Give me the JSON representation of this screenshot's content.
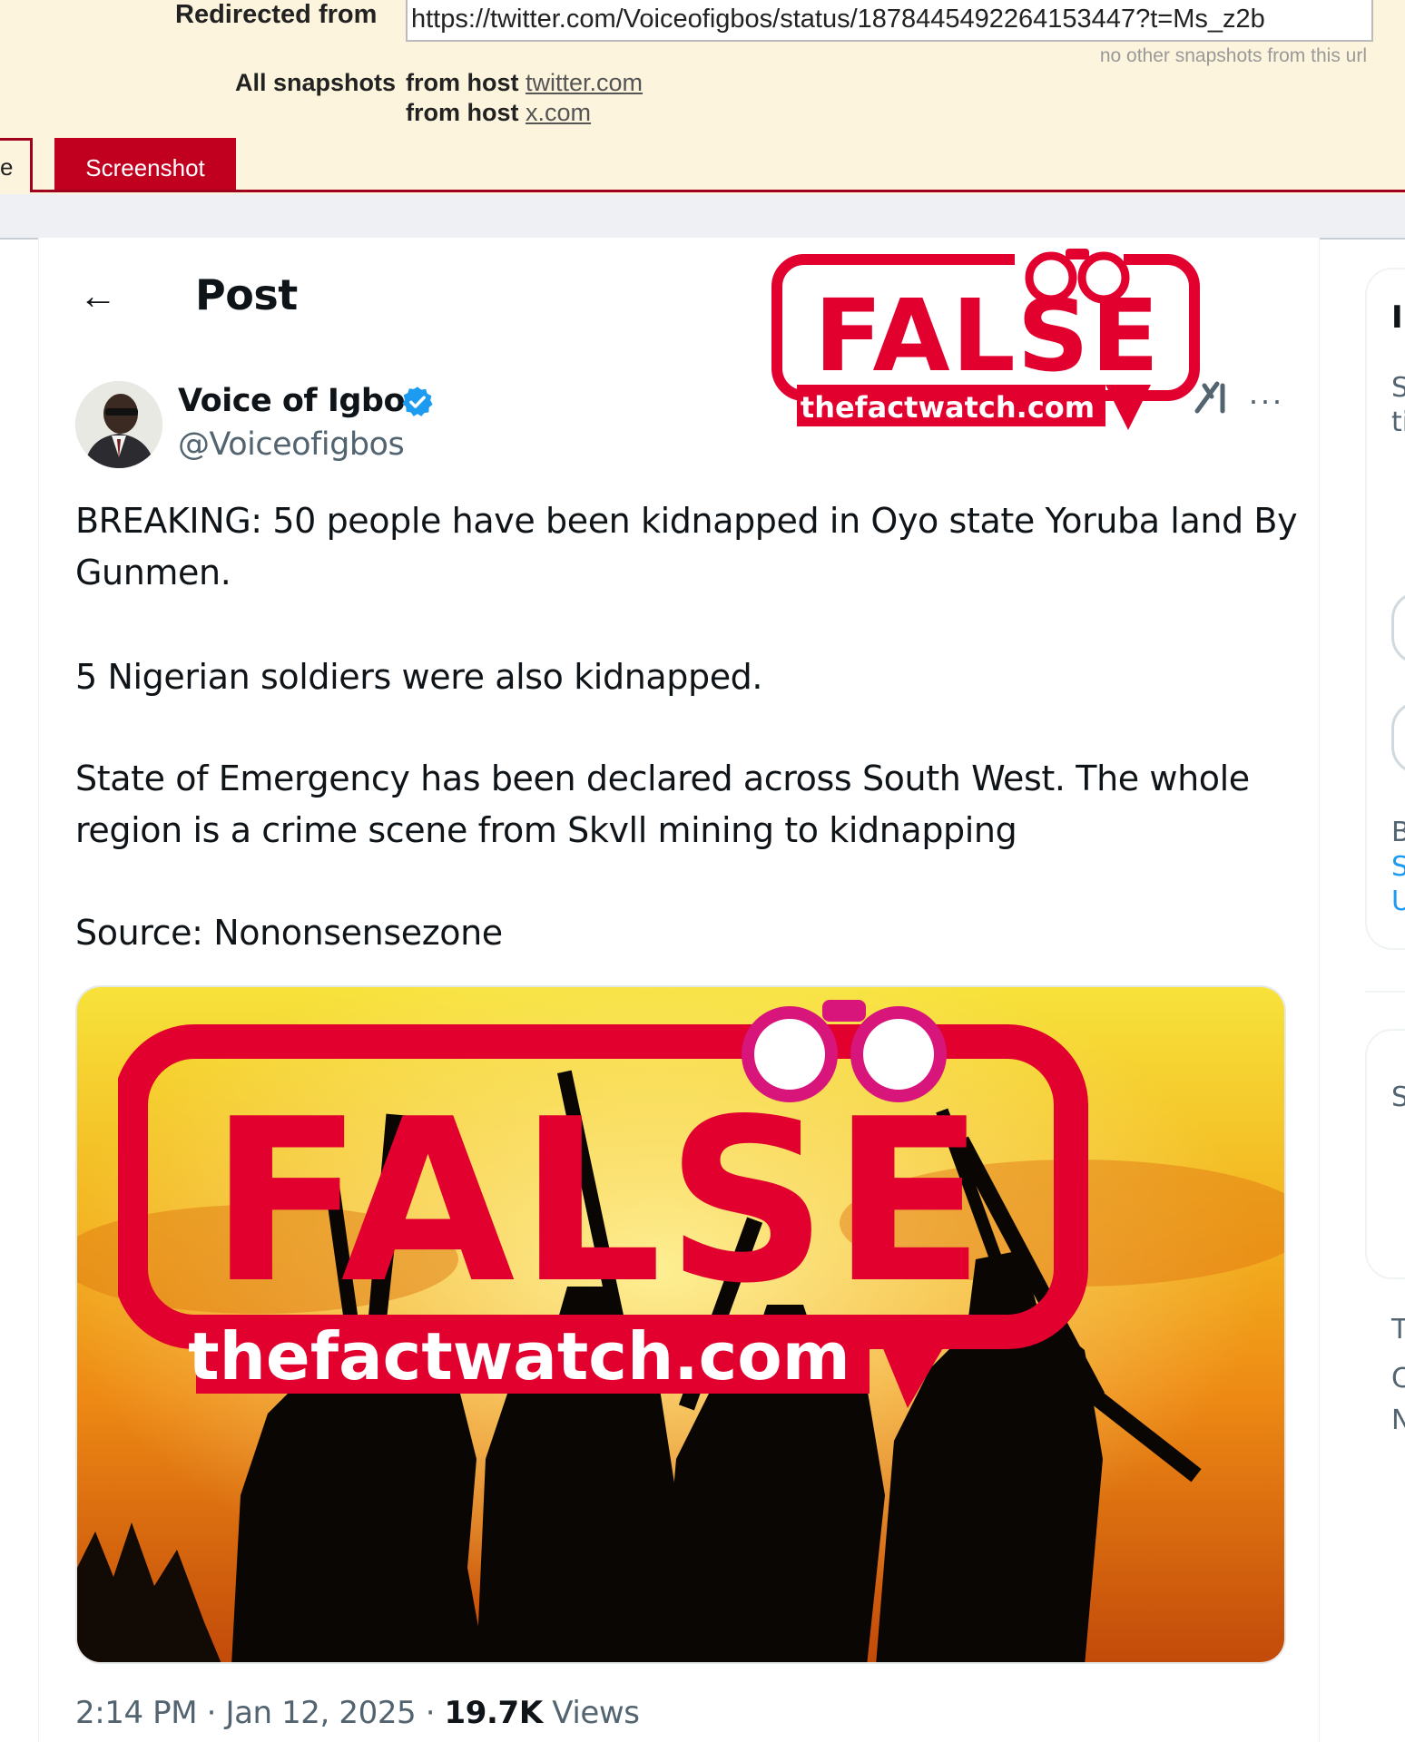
{
  "archive": {
    "redirected_label": "Redirected from",
    "redirected_url": "https://twitter.com/Voiceofigbos/status/1878445492264153447?t=Ms_z2b",
    "no_other_snapshots": "no other snapshots from this url",
    "all_snapshots_label": "All snapshots",
    "from_host_label": "from host",
    "hosts": [
      "twitter.com",
      "x.com"
    ],
    "tab_cut_label": "e",
    "active_tab": "Screenshot"
  },
  "post": {
    "header_title": "Post",
    "author_name": "Voice of Igbos",
    "author_handle": "@Voiceofigbos",
    "paragraphs": [
      "BREAKING: 50 people have been kidnapped in Oyo state Yoruba land By Gunmen.",
      "5 Nigerian soldiers were also kidnapped.",
      "State of Emergency has been declared  across South West. The whole region is a crime scene from Skvll mining to kidnapping",
      "Source: Nononsensezone"
    ],
    "time": "2:14 PM",
    "date": "Jan 12, 2025",
    "views_count": "19.7K",
    "views_label": "Views",
    "more_glyph": "···",
    "back_icon": "←"
  },
  "stamp": {
    "verdict": "FALSE",
    "site": "thefactwatch.com",
    "color": "#e2002f"
  },
  "sidebar_fragments": {
    "a": "S",
    "b": "ti",
    "c": "B",
    "d": "S",
    "e": "U",
    "f": "S",
    "g": "T",
    "h": "C",
    "i": "N"
  },
  "colors": {
    "verified_blue": "#1d9bf0",
    "archive_red": "#c1001f",
    "archive_bg": "#fcf4dc"
  }
}
